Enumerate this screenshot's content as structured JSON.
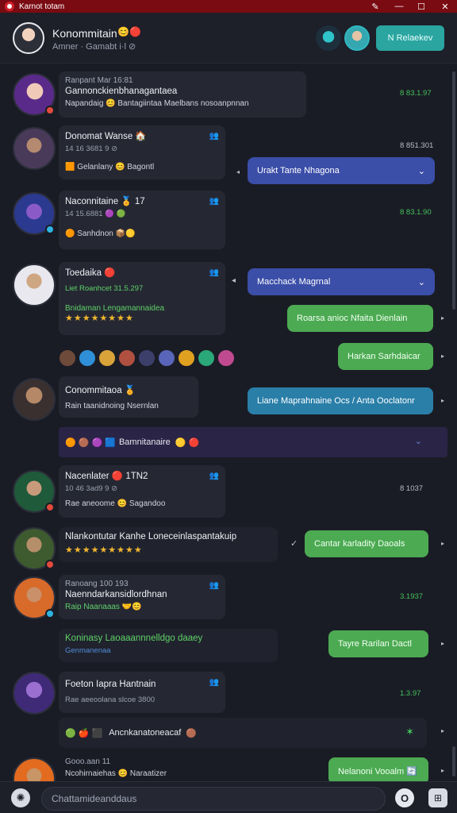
{
  "titlebar": {
    "title": "Karnot totam",
    "help_icon": "✎",
    "min_icon": "—",
    "max_icon": "☐",
    "close_icon": "✕"
  },
  "header": {
    "title": "Konommitain",
    "title_emoji": "😊🔴",
    "subtitle": "Amner · Gamabt i·l ⊘",
    "button_label": "N Relaekev"
  },
  "messages": [
    {
      "name": "Ranpant Mar 16:81",
      "meta": "Gannonckienbhanagantaea",
      "detail": "Napandaig 😊 Bantagiintaa Maelbans nosoanpnnan",
      "time": "8 83.1.97"
    },
    {
      "name": "Donomat Wanse 🏠",
      "meta": "14 16 3681 9 ⊘",
      "detail": "🟧 Gelanlany 😊 Bagontl",
      "corner": "👥",
      "time": "8 851.301",
      "reply": "Urakt Tante Nhagona"
    },
    {
      "name": "Naconnitaine 🏅 17",
      "meta": "14 15.6881 🟣 🟢",
      "detail": "🟠 Sanhdnon 📦🟡",
      "corner": "👥",
      "time": "8 83.1.90"
    },
    {
      "name": "Toedaika 🔴",
      "meta": "Liet Roanhcet 31.5.297",
      "detail": "Bnidaman Lengamannaidea",
      "stars": "★★★★★★★★",
      "corner": "👥",
      "reply": "Macchack Magrnal",
      "reply_green": "Roarsa anioc Nfaita Dienlain",
      "reply_green2": "Harkan Sarhdaicar"
    },
    {
      "name": "Conommitaoa 🏅",
      "detail": "Rain taanidnoing Nsernlan",
      "reply": "Liane Maprahnaine Ocs / Anta Ooclatonr"
    },
    {
      "bar_label": "Bamnitanaire"
    },
    {
      "name": "Nacenlater 🔴 1TN2",
      "meta": "10 46 3ad9 9 ⊘",
      "detail": "Rae aneoome 😊 Sagandoo",
      "corner": "👥",
      "time": "8 1037"
    },
    {
      "name": "Nlankontutar Kanhe Loneceinlaspantakuip",
      "stars": "★★★★★★★★★",
      "reply_green": "Cantar karladity Daoals"
    },
    {
      "name": "Ranoang 100 193",
      "meta": "Naenndarkansidlordhnan",
      "detail": "Raip Naanaaas 🤝😊",
      "corner": "👥",
      "time": "3.1937"
    },
    {
      "name": "Koninasy Laoaaannnelldgo daaey",
      "detail": "Genmanenaa",
      "reply_green": "Tayre Rarilan Dactl"
    },
    {
      "name": "Foeton Iapra Hantnain",
      "meta": "Rae aeeoolana slcoe 3800",
      "corner": "👥",
      "time": "1.3.97"
    },
    {
      "label": "Ancnkanatoneacaf"
    },
    {
      "name": "Gooo.aan 11",
      "detail": "Ncohirnaiehas 😊 Naraatizer",
      "reply_green": "Nelanoni Vooalm 🔄"
    }
  ],
  "composer": {
    "placeholder": "Chattamideanddaus"
  }
}
